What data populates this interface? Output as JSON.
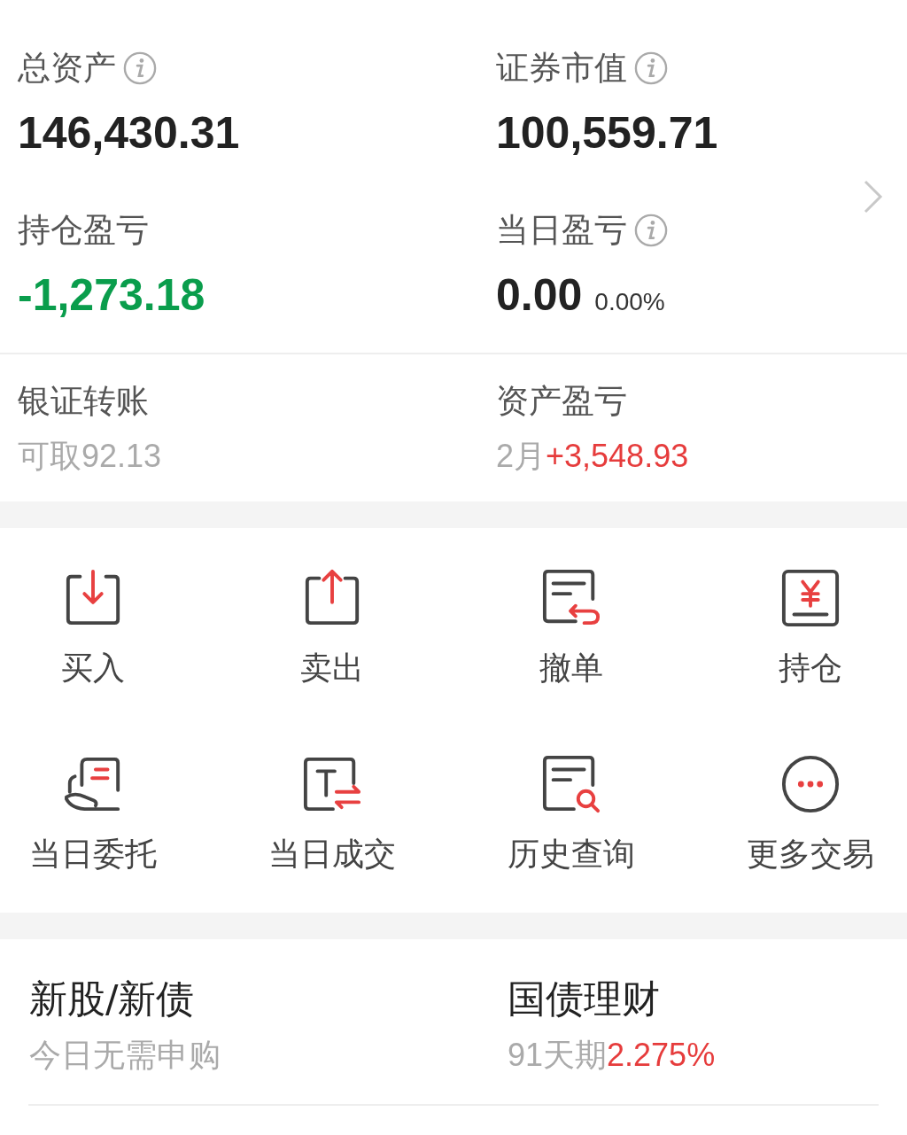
{
  "summary": [
    {
      "label": "总资产",
      "info": true,
      "value": "146,430.31",
      "color": "#222222"
    },
    {
      "label": "证券市值",
      "info": true,
      "value": "100,559.71",
      "color": "#222222"
    },
    {
      "label": "持仓盈亏",
      "info": false,
      "value": "-1,273.18",
      "color": "#0a9d4c"
    },
    {
      "label": "当日盈亏",
      "info": true,
      "value": "0.00",
      "color": "#222222",
      "extra": "0.00%"
    }
  ],
  "links": [
    {
      "label": "银证转账",
      "sub": [
        {
          "text": "可取92.13",
          "color": "#aaaaaa"
        }
      ]
    },
    {
      "label": "资产盈亏",
      "sub": [
        {
          "text": "2月",
          "color": "#aaaaaa"
        },
        {
          "text": "+3,548.93",
          "color": "#e63c3c"
        }
      ]
    }
  ],
  "actions": [
    {
      "label": "买入",
      "kind": "download"
    },
    {
      "label": "卖出",
      "kind": "upload"
    },
    {
      "label": "撤单",
      "kind": "revoke"
    },
    {
      "label": "持仓",
      "kind": "holding"
    },
    {
      "label": "当日委托",
      "kind": "hand"
    },
    {
      "label": "当日成交",
      "kind": "transfer"
    },
    {
      "label": "历史查询",
      "kind": "search"
    },
    {
      "label": "更多交易",
      "kind": "more"
    }
  ],
  "products": [
    {
      "title": "新股/新债",
      "sub": [
        {
          "text": "今日无需申购",
          "color": "#aaaaaa"
        }
      ]
    },
    {
      "title": "国债理财",
      "sub": [
        {
          "text": "91天期",
          "color": "#aaaaaa"
        },
        {
          "text": "2.275%",
          "color": "#e63c3c"
        }
      ]
    }
  ]
}
